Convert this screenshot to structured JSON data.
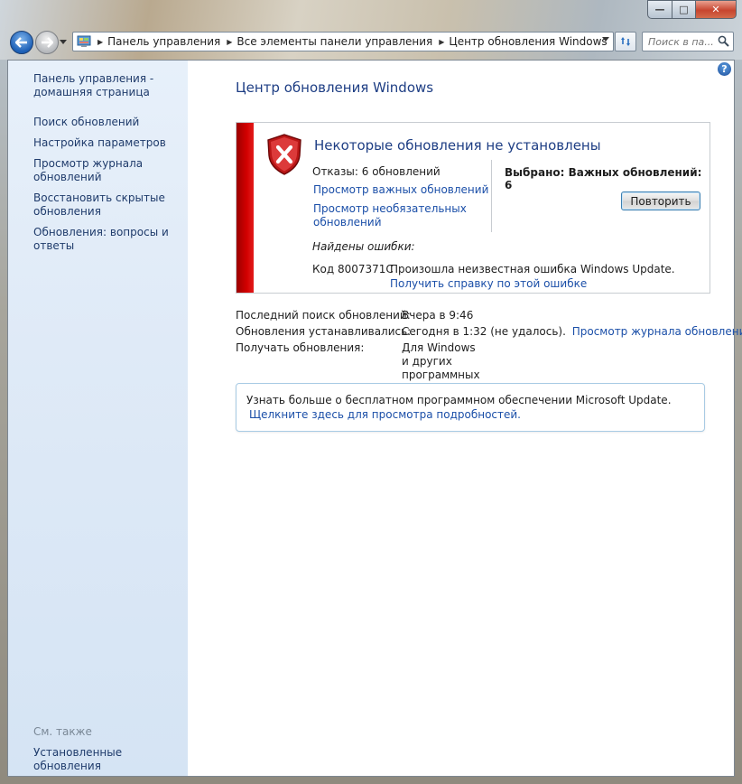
{
  "window": {
    "caption_buttons": {
      "minimize": "—",
      "maximize": "□",
      "close": "✕"
    }
  },
  "address": {
    "breadcrumbs": [
      "Панель управления",
      "Все элементы панели управления",
      "Центр обновления Windows"
    ]
  },
  "search": {
    "placeholder": "Поиск в па..."
  },
  "sidebar": {
    "items": [
      {
        "label": "Панель управления -\nдомашняя страница"
      },
      {
        "label": "Поиск обновлений"
      },
      {
        "label": "Настройка параметров"
      },
      {
        "label": "Просмотр журнала\nобновлений"
      },
      {
        "label": "Восстановить скрытые\nобновления"
      },
      {
        "label": "Обновления: вопросы и\nответы"
      }
    ],
    "see_also": "См. также",
    "see_also_items": [
      {
        "label": "Установленные обновления"
      }
    ]
  },
  "main": {
    "title": "Центр обновления Windows",
    "status": {
      "title": "Некоторые обновления не установлены",
      "failures": "Отказы: 6 обновлений",
      "link_important": "Просмотр важных обновлений",
      "link_optional": "Просмотр необязательных\nобновлений",
      "selected": "Выбрано: Важных обновлений: 6",
      "retry_label": "Повторить",
      "errors_label": "Найдены ошибки:",
      "error_code": "Код 8007371C",
      "error_message": "Произошла неизвестная ошибка Windows Update.",
      "error_help_link": "Получить справку по этой ошибке"
    },
    "info": {
      "last_search_label": "Последний поиск обновлений:",
      "last_search_value": "Вчера в 9:46",
      "installed_label": "Обновления устанавливались:",
      "installed_value": "Сегодня в 1:32 (не удалось).",
      "history_link": "Просмотр журнала обновлений",
      "receive_label": "Получать обновления:",
      "receive_value": "Для Windows и других программных продуктов из Microsoft\nUpdate"
    },
    "promo": {
      "text": "Узнать больше о бесплатном программном обеспечении Microsoft Update.",
      "link": "Щелкните здесь для просмотра подробностей."
    }
  },
  "colors": {
    "accent_red": "#d30000",
    "link_blue": "#1b4fa8",
    "title_blue": "#1e3e84",
    "sidebar_bg": "#dfeaf7"
  }
}
